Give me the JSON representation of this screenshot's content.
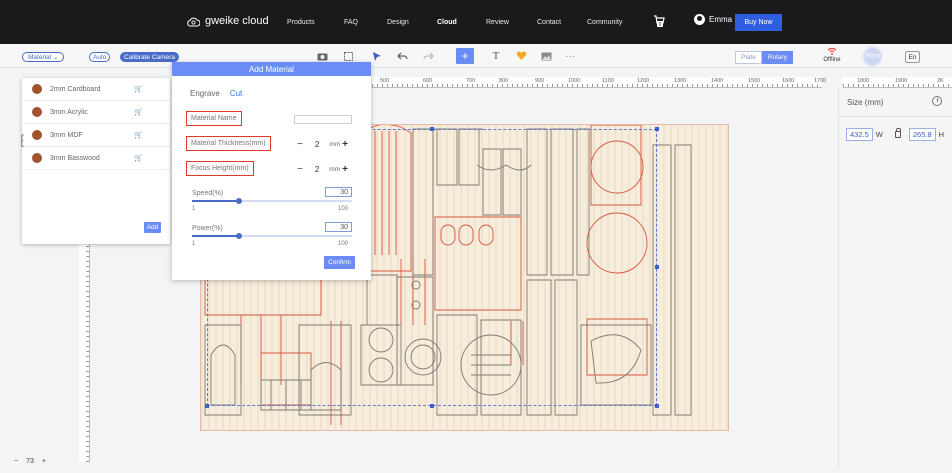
{
  "nav": {
    "brand": "gweike cloud",
    "links": [
      "Products",
      "FAQ",
      "Design",
      "Cloud",
      "Review",
      "Contact",
      "Community"
    ],
    "active_link": "Cloud",
    "cart_count": "0",
    "user": "Emma",
    "buy_now": "Buy Now"
  },
  "toolbar": {
    "material": "Material",
    "auto": "Auto",
    "calibrate": "Calibrate Camera",
    "icons": [
      "camera-icon",
      "frame-icon",
      "cursor-icon",
      "undo-icon",
      "redo-icon",
      "add-icon",
      "text-icon",
      "shape-icon",
      "image-icon",
      "more-icon"
    ],
    "mode_plate": "Plate",
    "mode_rotary": "Rotary",
    "status": "Offline",
    "print": "Print",
    "lang": "En"
  },
  "ruler": {
    "top": [
      "500",
      "600",
      "700",
      "800",
      "900",
      "1000",
      "1100",
      "1200",
      "1300",
      "1400",
      "1500",
      "1600",
      "1700"
    ],
    "top_right": [
      "1800",
      "1900",
      "2K"
    ]
  },
  "materials": {
    "items": [
      {
        "label": "2mm  Cardboard",
        "color": "#a0522d"
      },
      {
        "label": "3mm  Acrylic",
        "color": "#a0522d"
      },
      {
        "label": "3mm  MDF",
        "color": "#a0522d"
      },
      {
        "label": "3mm  Basswood",
        "color": "#a0522d"
      }
    ],
    "add": "Add"
  },
  "dialog": {
    "title": "Add Material",
    "tabs": [
      "Engrave",
      "Cut"
    ],
    "active_tab": "Cut",
    "name_label": "Material Name",
    "name_value": "",
    "thickness_label": "Material Thickness(mm)",
    "thickness_value": "2",
    "focus_label": "Focus Height(mm)",
    "focus_value": "2",
    "unit": "mm",
    "speed_label": "Speed(%)",
    "speed_value": "30",
    "power_label": "Power(%)",
    "power_value": "30",
    "min": "1",
    "max": "100",
    "confirm": "Confirm"
  },
  "right_panel": {
    "size_label": "Size (mm)",
    "width": "432.5",
    "w": "W",
    "height": "265.8",
    "h": "H"
  },
  "zoom": {
    "minus": "−",
    "value": "73",
    "plus": "+"
  }
}
